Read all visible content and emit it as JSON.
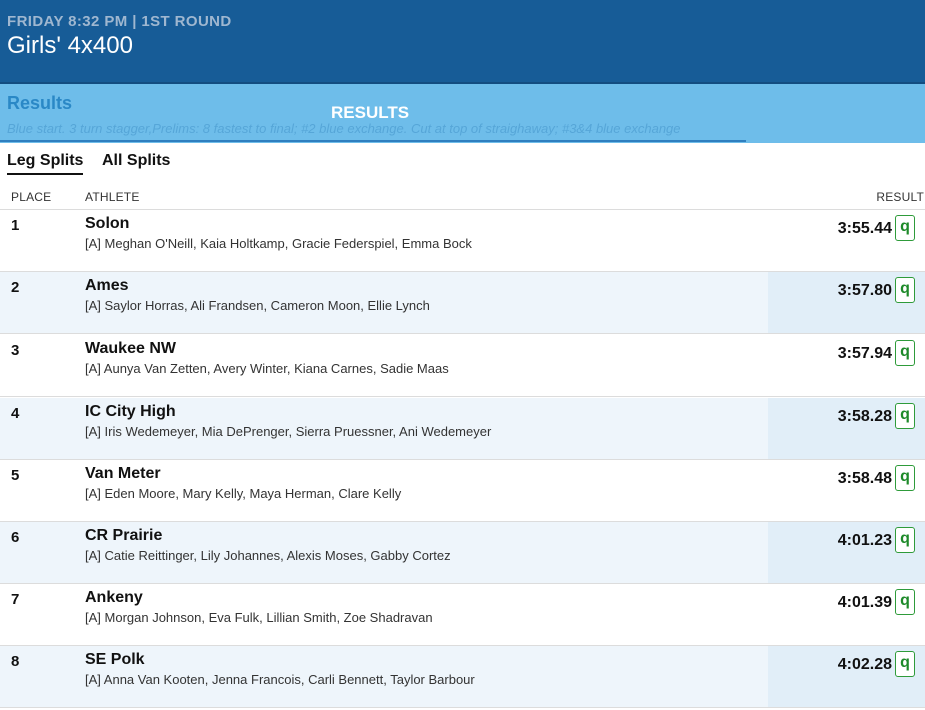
{
  "header": {
    "meta": "FRIDAY 8:32 PM | 1ST ROUND",
    "title": "Girls' 4x400"
  },
  "banner": {
    "label": "Results",
    "center_label": "RESULTS",
    "note": "Blue start. 3 turn stagger,Prelims: 8 fastest to final; #2 blue exchange. Cut at top of straighaway; #3&4 blue exchange"
  },
  "tabs": [
    {
      "label": "Leg Splits",
      "active": true
    },
    {
      "label": "All Splits",
      "active": false
    }
  ],
  "columns": {
    "place": "PLACE",
    "athlete": "ATHLETE",
    "result": "RESULT"
  },
  "rows": [
    {
      "place": "1",
      "team": "Solon",
      "athletes": "[A] Meghan O'Neill, Kaia Holtkamp, Gracie Federspiel, Emma Bock",
      "time": "3:55.44",
      "qual": "q"
    },
    {
      "place": "2",
      "team": "Ames",
      "athletes": "[A] Saylor Horras, Ali Frandsen, Cameron Moon, Ellie Lynch",
      "time": "3:57.80",
      "qual": "q"
    },
    {
      "place": "3",
      "team": "Waukee NW",
      "athletes": "[A] Aunya Van Zetten, Avery Winter, Kiana Carnes, Sadie Maas",
      "time": "3:57.94",
      "qual": "q"
    },
    {
      "place": "4",
      "team": "IC City High",
      "athletes": "[A] Iris Wedemeyer, Mia DePrenger, Sierra Pruessner, Ani Wedemeyer",
      "time": "3:58.28",
      "qual": "q"
    },
    {
      "place": "5",
      "team": "Van Meter",
      "athletes": "[A] Eden Moore, Mary Kelly, Maya Herman, Clare Kelly",
      "time": "3:58.48",
      "qual": "q"
    },
    {
      "place": "6",
      "team": "CR Prairie",
      "athletes": "[A] Catie Reittinger, Lily Johannes, Alexis Moses, Gabby Cortez",
      "time": "4:01.23",
      "qual": "q"
    },
    {
      "place": "7",
      "team": "Ankeny",
      "athletes": "[A] Morgan Johnson, Eva Fulk, Lillian Smith, Zoe Shadravan",
      "time": "4:01.39",
      "qual": "q"
    },
    {
      "place": "8",
      "team": "SE Polk",
      "athletes": "[A] Anna Van Kooten, Jenna Francois, Carli Bennett, Taylor Barbour",
      "time": "4:02.28",
      "qual": "q"
    }
  ],
  "colors": {
    "header_bg": "#175c97",
    "banner_bg": "#6ebdea",
    "qualifier_green": "#1e8a2a"
  }
}
